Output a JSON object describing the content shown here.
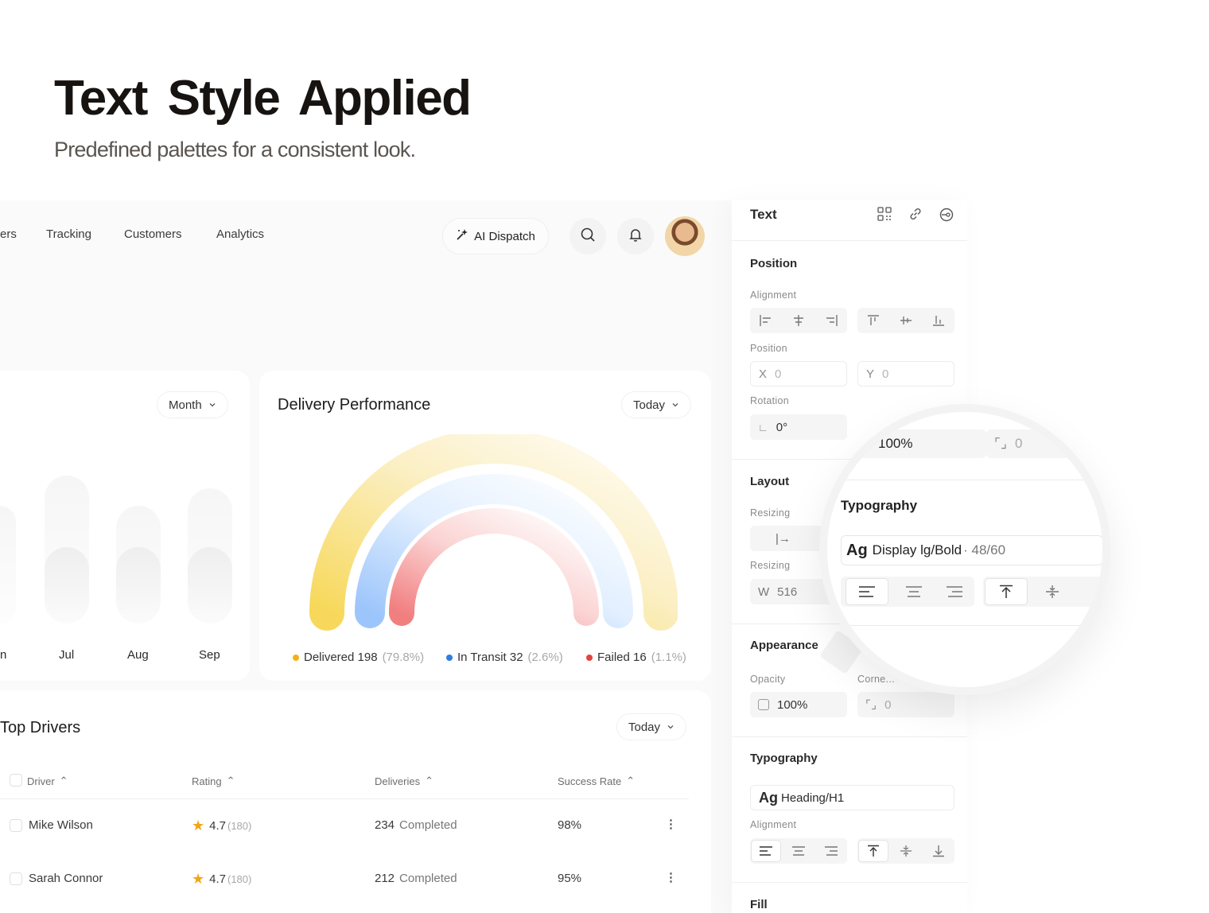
{
  "hero": {
    "title": "Text  Style Applied",
    "subtitle": "Predefined palettes for a consistent look."
  },
  "nav": {
    "partial_item": "ers",
    "items": [
      "Tracking",
      "Customers",
      "Analytics"
    ],
    "ai_button": "AI Dispatch"
  },
  "shipments": {
    "range": "Month",
    "months": [
      "n",
      "Jul",
      "Aug",
      "Sep"
    ]
  },
  "delivery": {
    "title": "Delivery Performance",
    "range": "Today",
    "legend": [
      {
        "label": "Delivered 198",
        "pct": "(79.8%)",
        "color": "#f2b11a"
      },
      {
        "label": "In Transit 32",
        "pct": "(2.6%)",
        "color": "#2f7de1"
      },
      {
        "label": "Failed 16",
        "pct": "(1.1%)",
        "color": "#e5433f"
      }
    ]
  },
  "drivers": {
    "title": "Top Drivers",
    "range": "Today",
    "columns": [
      "Driver",
      "Rating",
      "Deliveries",
      "Success Rate"
    ],
    "rows": [
      {
        "name": "Mike Wilson",
        "rating": "4.7",
        "reviews": "(180)",
        "deliveries": "234",
        "status": "Completed",
        "success": "98%"
      },
      {
        "name": "Sarah Connor",
        "rating": "4.7",
        "reviews": "(180)",
        "deliveries": "212",
        "status": "Completed",
        "success": "95%"
      }
    ]
  },
  "panel": {
    "title": "Text",
    "position_title": "Position",
    "alignment_label": "Alignment",
    "position_label": "Position",
    "x_label": "X",
    "x_value": "0",
    "y_label": "Y",
    "y_value": "0",
    "rotation_label": "Rotation",
    "rotation_value": "0°",
    "layout_title": "Layout",
    "resizing_label_1": "Resizing",
    "resizing_label_2": "Resizing",
    "w_label": "W",
    "w_value": "516",
    "appearance_title": "Appearance",
    "opacity_label": "Opacity",
    "opacity_value": "100%",
    "corner_label": "Corne...",
    "corner_value": "0",
    "typography_title": "Typography",
    "typography_style": "Heading/H1",
    "typography_ag": "Ag",
    "typo_alignment_label": "Alignment",
    "fill_title": "Fill"
  },
  "magnifier": {
    "opacity_value": "100%",
    "corner_value": "0",
    "typography_title": "Typography",
    "ag": "Ag",
    "style_name": "Display lg/Bold",
    "style_size": "· 48/60"
  }
}
